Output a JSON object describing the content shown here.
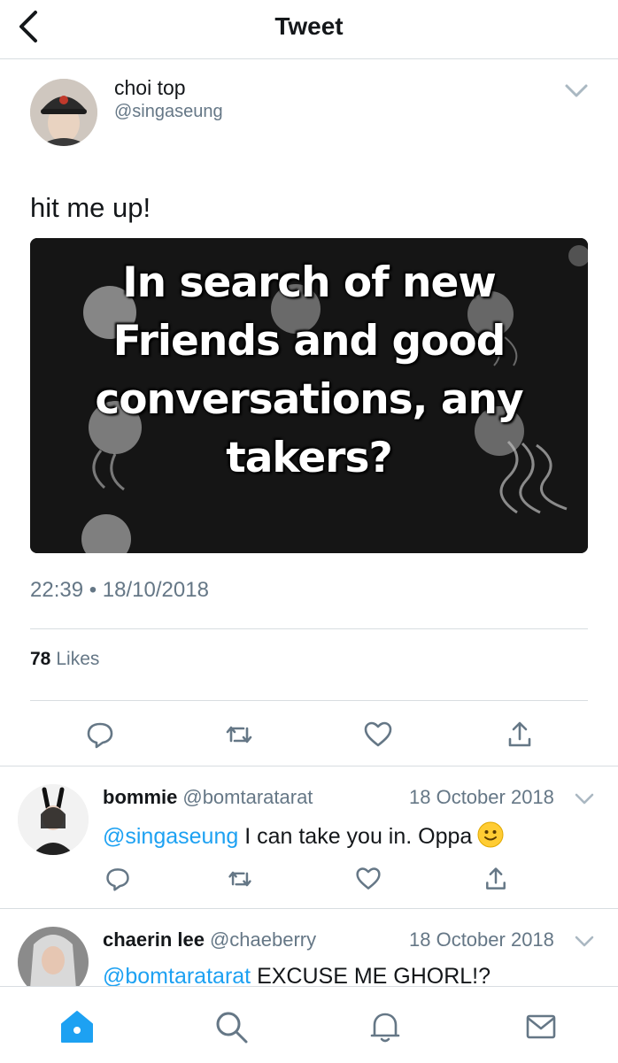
{
  "header": {
    "title": "Tweet",
    "back_icon": "chevron-left-icon"
  },
  "tweet": {
    "author_name": "choi top",
    "author_handle": "@singaseung",
    "text": "hit me up!",
    "media_text_lines": [
      "In search of new",
      "Friends and good",
      "conversations, any",
      "takers?"
    ],
    "timestamp": "22:39 • 18/10/2018",
    "likes_count": "78",
    "likes_label": "Likes",
    "actions": [
      "reply-icon",
      "retweet-icon",
      "like-icon",
      "share-icon"
    ]
  },
  "replies": [
    {
      "name": "bommie",
      "handle": "@bomtaratarat",
      "date": "18 October 2018",
      "mention": "@singaseung",
      "text": " I can take you in. Oppa",
      "emoji": "slightly-smiling-face"
    },
    {
      "name": "chaerin lee",
      "handle": "@chaeberry",
      "date": "18 October 2018",
      "mention": "@bomtaratarat",
      "text": " EXCUSE ME GHORL!?"
    }
  ],
  "tabbar": {
    "items": [
      "home-icon",
      "search-icon",
      "notifications-icon",
      "messages-icon"
    ],
    "active": "home-icon"
  },
  "colors": {
    "accent": "#1da1f2",
    "secondary_text": "#657786",
    "divider": "#d8dde1"
  }
}
